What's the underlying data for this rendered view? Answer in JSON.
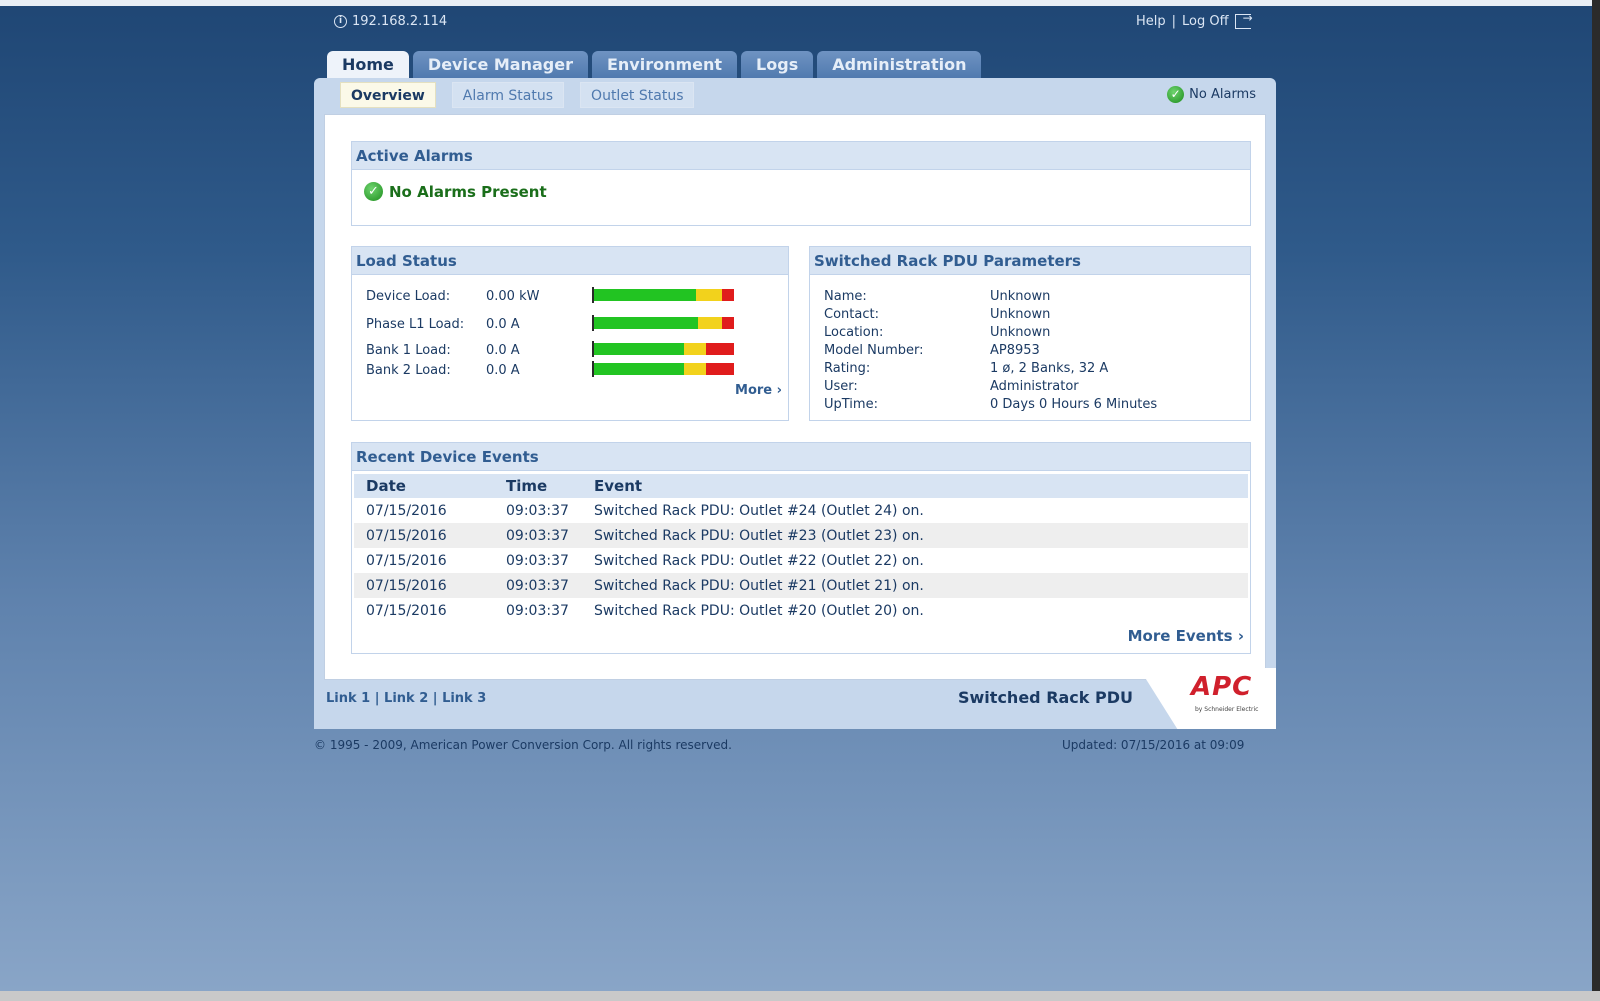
{
  "header": {
    "ip": "192.168.2.114",
    "help": "Help",
    "separator": "|",
    "logoff": "Log Off"
  },
  "tabs": [
    {
      "label": "Home",
      "active": true
    },
    {
      "label": "Device Manager"
    },
    {
      "label": "Environment"
    },
    {
      "label": "Logs"
    },
    {
      "label": "Administration"
    }
  ],
  "subtabs": [
    {
      "label": "Overview",
      "active": true
    },
    {
      "label": "Alarm Status"
    },
    {
      "label": "Outlet Status"
    }
  ],
  "status": {
    "top_alarm": "No Alarms"
  },
  "active_alarms": {
    "title": "Active Alarms",
    "message": "No Alarms Present"
  },
  "load_status": {
    "title": "Load Status",
    "rows": [
      {
        "label": "Device Load:",
        "value": "0.00 kW"
      },
      {
        "label": "Phase L1 Load:",
        "value": "0.0 A"
      },
      {
        "label": "Bank 1 Load:",
        "value": "0.0 A"
      },
      {
        "label": "Bank 2 Load:",
        "value": "0.0 A"
      }
    ],
    "more": "More ›",
    "colors": {
      "green": "#22c422",
      "yellow": "#f2d21c",
      "red": "#e01c1c"
    }
  },
  "params": {
    "title": "Switched Rack PDU Parameters",
    "rows": [
      {
        "label": "Name:",
        "value": "Unknown"
      },
      {
        "label": "Contact:",
        "value": "Unknown"
      },
      {
        "label": "Location:",
        "value": "Unknown"
      },
      {
        "label": "Model Number:",
        "value": "AP8953"
      },
      {
        "label": "Rating:",
        "value": "1 ø, 2 Banks, 32 A"
      },
      {
        "label": "User:",
        "value": "Administrator"
      },
      {
        "label": "UpTime:",
        "value": "0 Days 0 Hours 6 Minutes"
      }
    ]
  },
  "events": {
    "title": "Recent Device Events",
    "columns": [
      "Date",
      "Time",
      "Event"
    ],
    "rows": [
      [
        "07/15/2016",
        "09:03:37",
        "Switched Rack PDU: Outlet #24 (Outlet 24) on."
      ],
      [
        "07/15/2016",
        "09:03:37",
        "Switched Rack PDU: Outlet #23 (Outlet 23) on."
      ],
      [
        "07/15/2016",
        "09:03:37",
        "Switched Rack PDU: Outlet #22 (Outlet 22) on."
      ],
      [
        "07/15/2016",
        "09:03:37",
        "Switched Rack PDU: Outlet #21 (Outlet 21) on."
      ],
      [
        "07/15/2016",
        "09:03:37",
        "Switched Rack PDU: Outlet #20 (Outlet 20) on."
      ]
    ],
    "more": "More Events ›"
  },
  "footer": {
    "links": [
      "Link 1",
      "Link 2",
      "Link 3"
    ],
    "product": "Switched Rack PDU",
    "logo": "APC",
    "logo_sub": "by Schneider Electric",
    "copyright": "© 1995 - 2009, American Power Conversion Corp. All rights reserved.",
    "updated": "Updated: 07/15/2016 at 09:09"
  }
}
